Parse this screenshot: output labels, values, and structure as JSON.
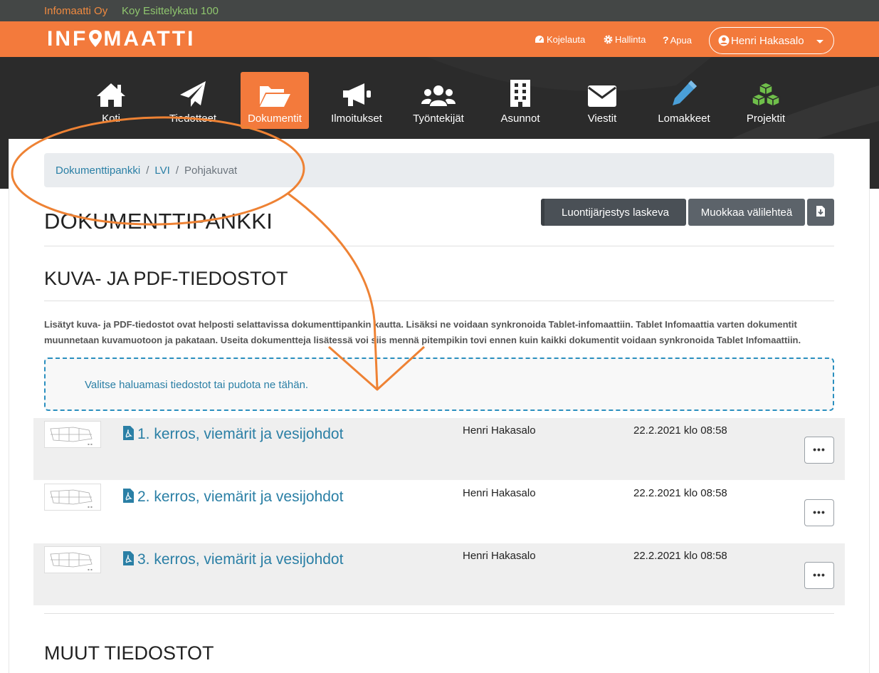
{
  "topbar": {
    "company": "Infomaatti Oy",
    "building": "Koy Esittelykatu 100"
  },
  "header": {
    "logo": "INFOMAATTI",
    "links": [
      {
        "label": "Kojelauta",
        "icon": "dashboard-icon"
      },
      {
        "label": "Hallinta",
        "icon": "gear-icon"
      },
      {
        "label": "Apua",
        "icon": "question-icon"
      }
    ],
    "user": "Henri Hakasalo"
  },
  "nav": [
    {
      "label": "Koti",
      "icon": "home-icon"
    },
    {
      "label": "Tiedotteet",
      "icon": "paper-plane-icon"
    },
    {
      "label": "Dokumentit",
      "icon": "folder-open-icon",
      "active": true
    },
    {
      "label": "Ilmoitukset",
      "icon": "megaphone-icon"
    },
    {
      "label": "Työntekijät",
      "icon": "users-icon"
    },
    {
      "label": "Asunnot",
      "icon": "building-icon"
    },
    {
      "label": "Viestit",
      "icon": "envelope-icon"
    },
    {
      "label": "Lomakkeet",
      "icon": "pencil-icon"
    },
    {
      "label": "Projektit",
      "icon": "cubes-icon"
    }
  ],
  "breadcrumb": {
    "items": [
      "Dokumenttipankki",
      "LVI"
    ],
    "current": "Pohjakuvat"
  },
  "actions": {
    "sort": "Luontijärjestys laskeva",
    "edit_tab": "Muokkaa välilehteä",
    "download_icon": "download-icon"
  },
  "page_title": "DOKUMENTTIPANKKI",
  "section1": {
    "title": "KUVA- JA PDF-TIEDOSTOT",
    "description_line1": "Lisätyt kuva- ja PDF-tiedostot ovat helposti selattavissa dokumenttipankin kautta. Lisäksi ne voidaan synkronoida Tablet-infomaattiin. Tablet Infomaattia varten dokumentit",
    "description_line2": "muunnetaan kuvamuotoon ja pakataan. Useita dokumentteja lisätessä voi siis mennä pitempikin tovi ennen kuin kaikki dokumentit voidaan synkronoida Tablet Infomaattiin.",
    "dropzone": "Valitse haluamasi tiedostot tai pudota ne tähän."
  },
  "files": [
    {
      "name": "1. kerros, viemärit ja vesijohdot",
      "owner": "Henri Hakasalo",
      "date": "22.2.2021 klo 08:58",
      "more": "•••"
    },
    {
      "name": "2. kerros, viemärit ja vesijohdot",
      "owner": "Henri Hakasalo",
      "date": "22.2.2021 klo 08:58",
      "more": "•••"
    },
    {
      "name": "3. kerros, viemärit ja vesijohdot",
      "owner": "Henri Hakasalo",
      "date": "22.2.2021 klo 08:58",
      "more": "•••"
    }
  ],
  "section2": {
    "title": "MUUT TIEDOSTOT"
  },
  "colors": {
    "brand_orange": "#f37a3c",
    "nav_dark": "#2b2b2b",
    "link_blue": "#2a7fa5",
    "annotation_orange": "#ee8234"
  }
}
